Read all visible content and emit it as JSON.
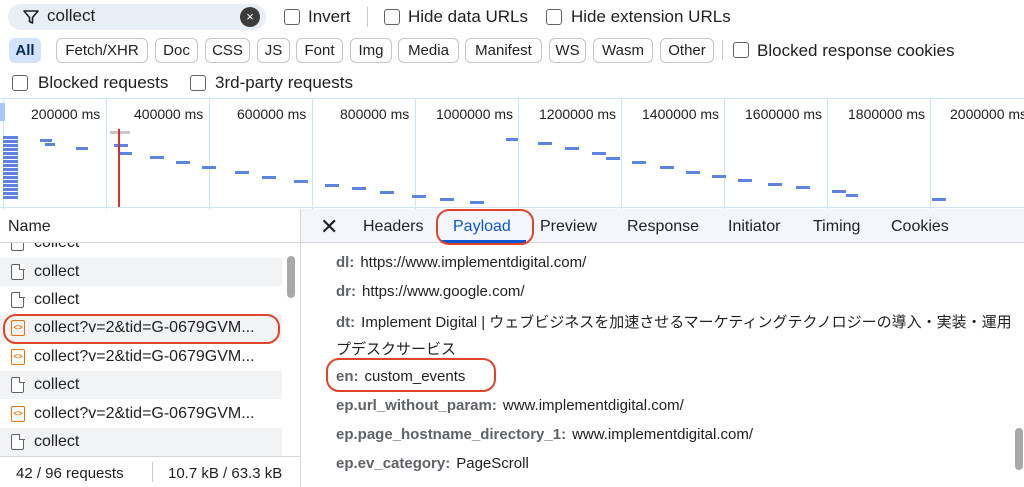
{
  "filter": {
    "value": "collect",
    "clear_icon": "×"
  },
  "options_row1": {
    "invert": "Invert",
    "hide_data_urls": "Hide data URLs",
    "hide_extension_urls": "Hide extension URLs"
  },
  "type_chips": [
    "All",
    "Fetch/XHR",
    "Doc",
    "CSS",
    "JS",
    "Font",
    "Img",
    "Media",
    "Manifest",
    "WS",
    "Wasm",
    "Other"
  ],
  "blocked_response_cookies": "Blocked response cookies",
  "options_row3": {
    "blocked_requests": "Blocked requests",
    "third_party_requests": "3rd-party requests"
  },
  "timeline": {
    "labels": [
      "200000 ms",
      "400000 ms",
      "600000 ms",
      "800000 ms",
      "1000000 ms",
      "1200000 ms",
      "1400000 ms",
      "1600000 ms",
      "1800000 ms",
      "2000000 ms"
    ]
  },
  "requests": {
    "header": "Name",
    "rows": [
      {
        "name": "collect",
        "type": "doc"
      },
      {
        "name": "collect",
        "type": "doc"
      },
      {
        "name": "collect",
        "type": "doc"
      },
      {
        "name": "collect?v=2&tid=G-0679GVM...",
        "type": "script"
      },
      {
        "name": "collect?v=2&tid=G-0679GVM...",
        "type": "script"
      },
      {
        "name": "collect",
        "type": "doc"
      },
      {
        "name": "collect?v=2&tid=G-0679GVM...",
        "type": "script"
      },
      {
        "name": "collect",
        "type": "doc"
      }
    ]
  },
  "status": {
    "requests": "42 / 96 requests",
    "transferred": "10.7 kB / 63.3 kB"
  },
  "tabs": [
    "Headers",
    "Payload",
    "Preview",
    "Response",
    "Initiator",
    "Timing",
    "Cookies"
  ],
  "active_tab": "Payload",
  "payload": [
    {
      "key": "dl:",
      "value": "https://www.implementdigital.com/"
    },
    {
      "key": "dr:",
      "value": "https://www.google.com/"
    },
    {
      "key": "dt:",
      "value": "Implement Digital | ウェブビジネスを加速させるマーケティングテクノロジーの導入・実装・運用・ヘル"
    },
    {
      "key": "",
      "value": "プデスクサービス"
    },
    {
      "key": "en:",
      "value": "custom_events"
    },
    {
      "key": "ep.url_without_param:",
      "value": "www.implementdigital.com/"
    },
    {
      "key": "ep.page_hostname_directory_1:",
      "value": "www.implementdigital.com/"
    },
    {
      "key": "ep.ev_category:",
      "value": "PageScroll"
    }
  ],
  "colors": {
    "accent": "#0b57d0",
    "annotation": "#e0442c",
    "waterfall": "#5d84e3"
  }
}
